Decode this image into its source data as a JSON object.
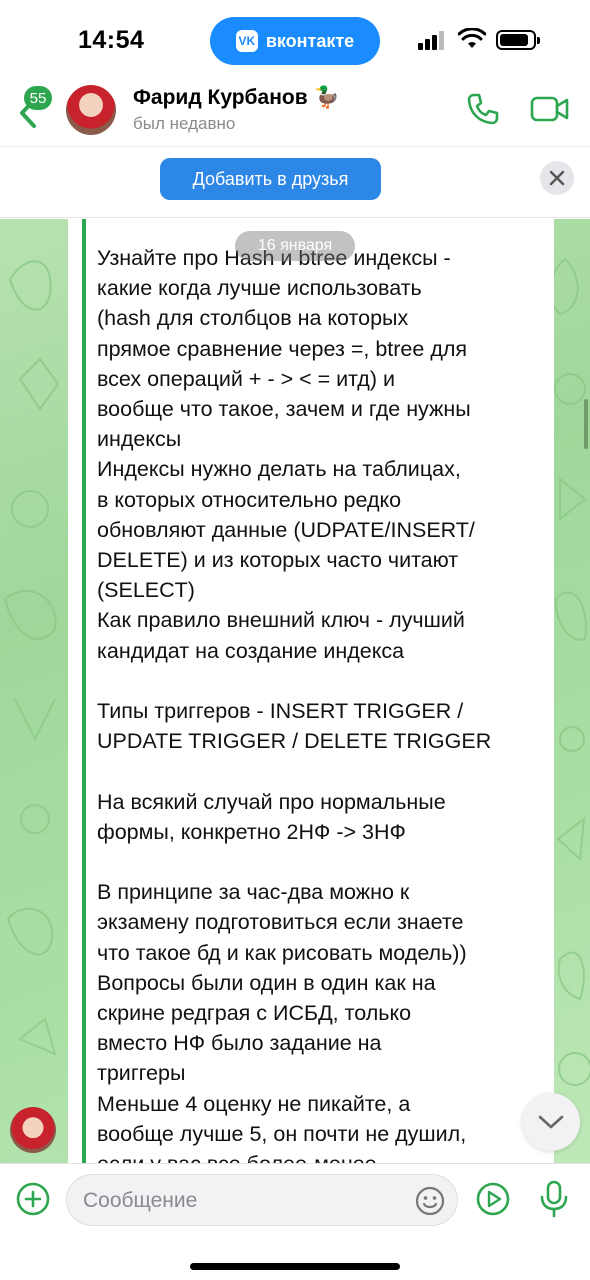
{
  "status_bar": {
    "time": "14:54",
    "app_pill": "вконтакте",
    "app_logo": "VK"
  },
  "header": {
    "unread_count": "55",
    "name": "Фарид Курбанов 🦆",
    "status": "был недавно",
    "icons": {
      "back": "chevron-left-icon",
      "call": "phone-icon",
      "video": "video-camera-icon"
    }
  },
  "friend_bar": {
    "add_friend_label": "Добавить в друзья",
    "close_icon": "close-icon"
  },
  "chat": {
    "date": "16 января",
    "message_text": "Узнайте про Hash и btree индексы -\nкакие когда лучше использовать\n(hash для столбцов на которых\nпрямое сравнение через =, btree для\nвсех операций + - > < = итд) и\nвообще что такое, зачем и где нужны\nиндексы\nИндексы нужно делать на таблицах,\nв которых относительно редко\nобновляют данные (UDPATE/INSERT/\nDELETE) и из которых часто читают\n(SELECT)\nКак правило внешний ключ - лучший\nкандидат на создание индекса\n\nТипы триггеров - INSERT TRIGGER /\nUPDATE TRIGGER / DELETE TRIGGER\n\nНа всякий случай про нормальные\nформы, конкретно 2НФ -> 3НФ\n\nВ принципе за час-два можно к\nэкзамену подготовиться если знаете\nчто такое бд и как рисовать модель))\nВопросы были один в один как на\nскрине редграя с ИСБД, только\nвместо НФ было задание на\nтриггеры\nМеньше 4 оценку не пикайте, а\nвообще лучше 5, он почти не душил,\nесли у вас все более-менее",
    "colors": {
      "quote_bar": "#2ea650",
      "background": "#a9dfa3"
    }
  },
  "composer": {
    "placeholder": "Сообщение",
    "icons": {
      "attach": "plus-circle-icon",
      "emoji": "smile-icon",
      "play": "play-circle-icon",
      "mic": "microphone-icon"
    }
  }
}
